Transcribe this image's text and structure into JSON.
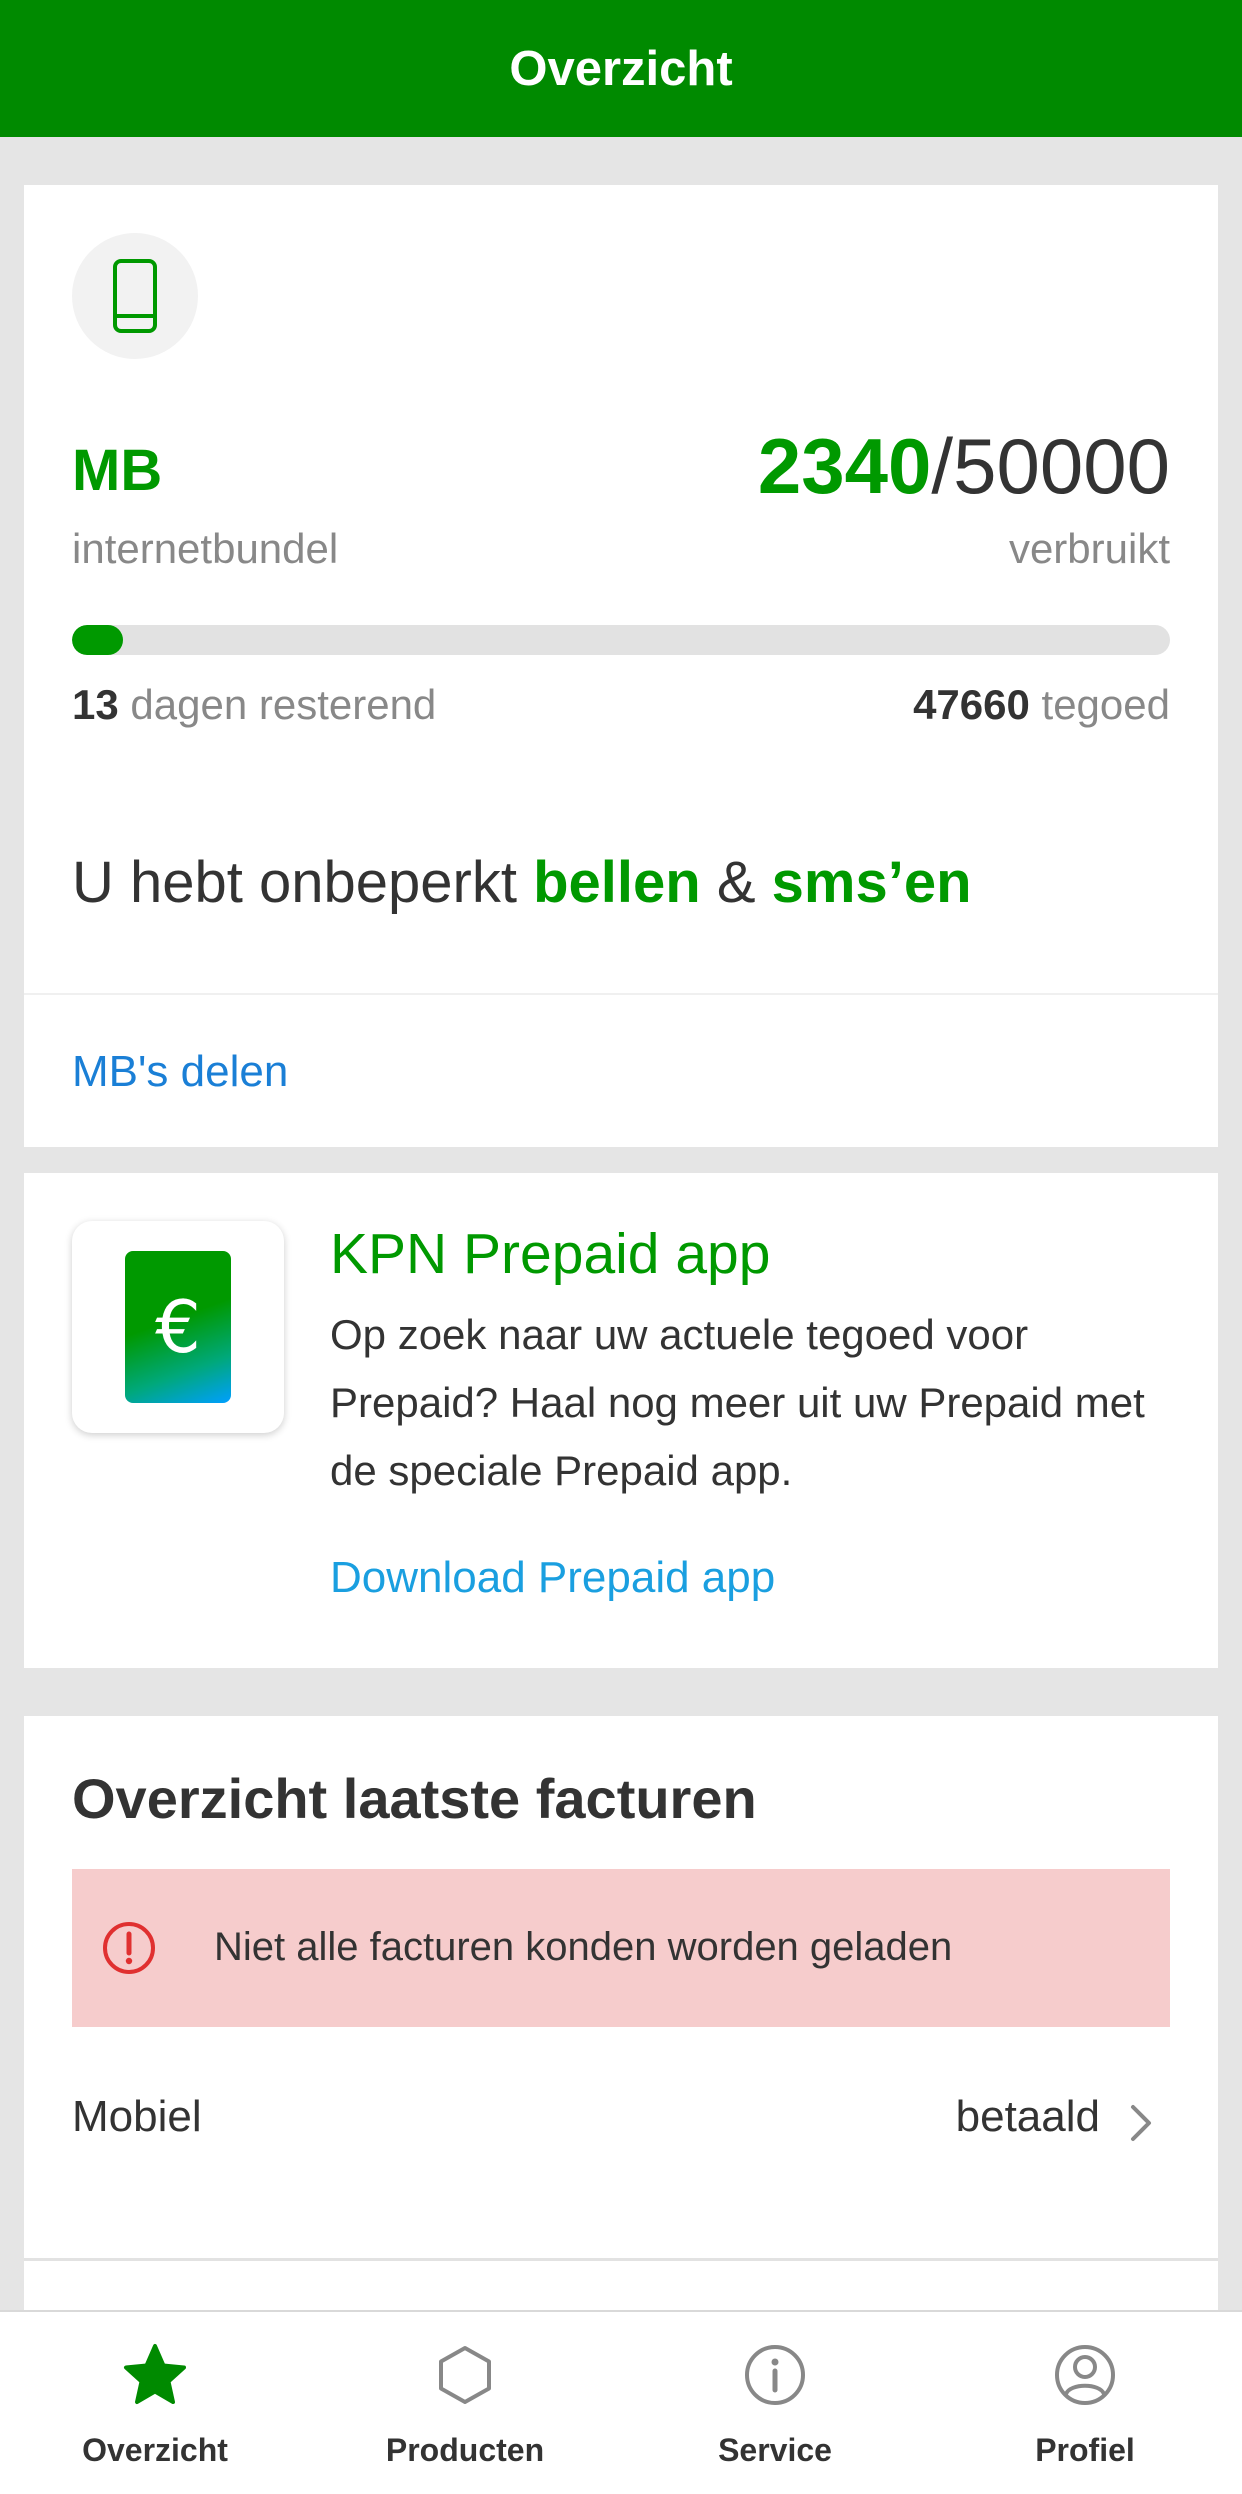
{
  "header": {
    "title": "Overzicht"
  },
  "bundle": {
    "unit": "MB",
    "type_label": "internetbundel",
    "used": "2340",
    "separator": "/",
    "total": "50000",
    "used_label": "verbruikt",
    "usage_fraction": 0.0468,
    "days_value": "13",
    "days_label": "dagen resterend",
    "credit_value": "47660",
    "credit_label": "tegoed",
    "unlimited_prefix": "U hebt onbeperkt",
    "unlimited_calling": "bellen",
    "unlimited_amp": "&",
    "unlimited_sms": "sms’en",
    "share_link": "MB's delen"
  },
  "promo": {
    "app_icon_symbol": "€",
    "title": "KPN Prepaid app",
    "body": "Op zoek naar uw actuele tegoed voor Prepaid? Haal nog meer uit uw Prepaid met de speciale Prepaid app.",
    "link": "Download Prepaid app"
  },
  "invoices": {
    "title": "Overzicht laatste facturen",
    "error": "Niet alle facturen konden worden geladen",
    "rows": [
      {
        "label": "Mobiel",
        "status": "betaald"
      }
    ]
  },
  "nav": {
    "items": [
      {
        "label": "Overzicht",
        "icon": "star-icon",
        "active": true
      },
      {
        "label": "Producten",
        "icon": "hexagon-icon",
        "active": false
      },
      {
        "label": "Service",
        "icon": "info-icon",
        "active": false
      },
      {
        "label": "Profiel",
        "icon": "profile-icon",
        "active": false
      }
    ]
  },
  "colors": {
    "brand_green": "#009900",
    "header_green": "#008a00",
    "link_blue": "#1a7fd6",
    "error_bg": "#f6cccc",
    "error_red": "#e03030"
  }
}
